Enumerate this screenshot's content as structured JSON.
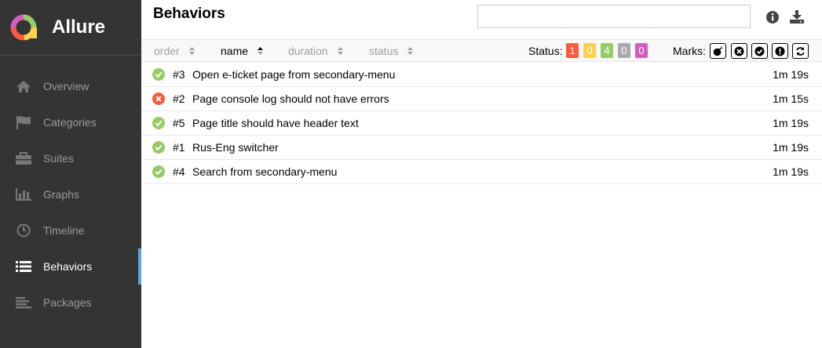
{
  "app": {
    "name": "Allure"
  },
  "sidebar": {
    "items": [
      {
        "label": "Overview",
        "icon": "home-icon"
      },
      {
        "label": "Categories",
        "icon": "flag-icon"
      },
      {
        "label": "Suites",
        "icon": "briefcase-icon"
      },
      {
        "label": "Graphs",
        "icon": "bar-chart-icon"
      },
      {
        "label": "Timeline",
        "icon": "clock-icon"
      },
      {
        "label": "Behaviors",
        "icon": "list-icon",
        "active": true
      },
      {
        "label": "Packages",
        "icon": "align-left-icon"
      }
    ]
  },
  "header": {
    "title": "Behaviors",
    "search": {
      "value": "",
      "placeholder": ""
    }
  },
  "sorters": {
    "order": "order",
    "name": "name",
    "duration": "duration",
    "status": "status",
    "active": "name"
  },
  "status_filter": {
    "label": "Status:",
    "counts": [
      {
        "value": "1",
        "color": "#fd5a3e"
      },
      {
        "value": "0",
        "color": "#ffd050"
      },
      {
        "value": "4",
        "color": "#97cc64"
      },
      {
        "value": "0",
        "color": "#aaaaaa"
      },
      {
        "value": "0",
        "color": "#d35ebe"
      }
    ]
  },
  "marks": {
    "label": "Marks:",
    "items": [
      "bomb-icon",
      "times-circle-icon",
      "check-circle-icon",
      "exclamation-circle-icon",
      "refresh-icon"
    ]
  },
  "colors": {
    "passed": "#97cc64",
    "failed": "#fd5a3e",
    "active_accent": "#5aa5e6"
  },
  "tests": [
    {
      "order": "#3",
      "name": "Open e-ticket page from secondary-menu",
      "duration": "1m 19s",
      "status": "passed"
    },
    {
      "order": "#2",
      "name": "Page console log should not have errors",
      "duration": "1m 15s",
      "status": "failed"
    },
    {
      "order": "#5",
      "name": "Page title should have header text",
      "duration": "1m 19s",
      "status": "passed"
    },
    {
      "order": "#1",
      "name": "Rus-Eng switcher",
      "duration": "1m 19s",
      "status": "passed"
    },
    {
      "order": "#4",
      "name": "Search from secondary-menu",
      "duration": "1m 19s",
      "status": "passed"
    }
  ]
}
